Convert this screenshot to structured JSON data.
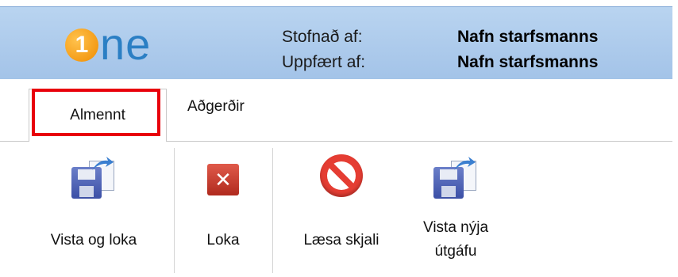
{
  "header": {
    "logo_digit": "1",
    "logo_text": "ne",
    "created_by_label": "Stofnað af:",
    "created_by_value": "Nafn starfsmanns",
    "updated_by_label": "Uppfært af:",
    "updated_by_value": "Nafn starfsmanns"
  },
  "tabs": [
    {
      "label": "Almennt",
      "active": true,
      "highlighted": true
    },
    {
      "label": "Aðgerðir",
      "active": false
    }
  ],
  "ribbon": {
    "buttons": [
      {
        "label": "Vista og loka",
        "icon": "save-close-icon"
      },
      {
        "label": "Loka",
        "icon": "close-icon"
      },
      {
        "label": "Læsa skjali",
        "icon": "lock-prohibited-icon"
      },
      {
        "label_line1": "Vista nýja",
        "label_line2": "útgáfu",
        "icon": "save-new-version-icon"
      }
    ]
  },
  "colors": {
    "header_bg": "#a3c3e8",
    "logo_blue": "#2b7fc4",
    "logo_orange": "#f08c00",
    "highlight_red": "#e8000b"
  }
}
